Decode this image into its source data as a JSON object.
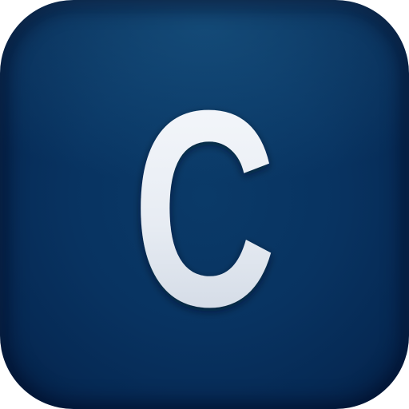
{
  "icon": {
    "letter": "C",
    "background_color": "#073260",
    "letter_color": "#e9eef5"
  }
}
